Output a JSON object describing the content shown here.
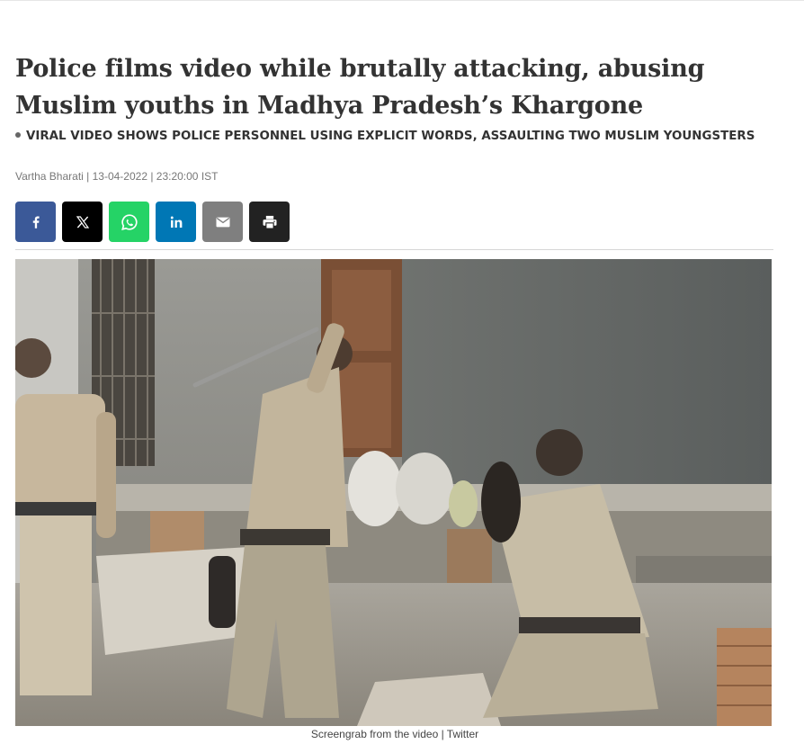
{
  "article": {
    "headline": "Police films video while brutally attacking, abusing Muslim youths in Madhya Pradesh’s Khargone",
    "subheadline": "VIRAL VIDEO SHOWS POLICE PERSONNEL USING EXPLICIT WORDS, ASSAULTING TWO MUSLIM YOUNGSTERS",
    "byline": "Vartha Bharati | 13-04-2022 | 23:20:00 IST"
  },
  "share": {
    "buttons": [
      {
        "name": "facebook",
        "icon": "facebook-icon",
        "color": "#3b5998"
      },
      {
        "name": "x",
        "icon": "x-icon",
        "color": "#000000"
      },
      {
        "name": "whatsapp",
        "icon": "whatsapp-icon",
        "color": "#25d366"
      },
      {
        "name": "linkedin",
        "icon": "linkedin-icon",
        "color": "#0077b5"
      },
      {
        "name": "email",
        "icon": "email-icon",
        "color": "#7f7f7f"
      },
      {
        "name": "print",
        "icon": "print-icon",
        "color": "#222222"
      }
    ]
  },
  "image": {
    "caption": "Screengrab from the video | Twitter"
  }
}
